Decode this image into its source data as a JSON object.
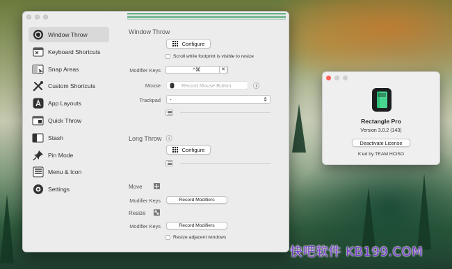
{
  "sidebar": {
    "items": [
      {
        "label": "Window Throw",
        "icon": "target-icon"
      },
      {
        "label": "Keyboard Shortcuts",
        "icon": "keyboard-window-icon"
      },
      {
        "label": "Snap Areas",
        "icon": "snap-areas-icon"
      },
      {
        "label": "Custom Shortcuts",
        "icon": "tools-icon"
      },
      {
        "label": "App Layouts",
        "icon": "app-store-icon"
      },
      {
        "label": "Quick Throw",
        "icon": "quick-throw-icon"
      },
      {
        "label": "Stash",
        "icon": "stash-icon"
      },
      {
        "label": "Pin Mode",
        "icon": "pin-icon"
      },
      {
        "label": "Menu & Icon",
        "icon": "menu-icon"
      },
      {
        "label": "Settings",
        "icon": "settings-icon"
      }
    ],
    "selected_index": 0
  },
  "window_throw": {
    "title": "Window Throw",
    "configure_label": "Configure",
    "scroll_checkbox_label": "Scroll while footprint is visible to resize",
    "modifier_keys_label": "Modifier Keys",
    "modifier_keys_value": "^⌘",
    "clear_symbol": "✕",
    "mouse_label": "Mouse",
    "mouse_placeholder": "Record Mouse Button",
    "info_symbol": "ⓘ",
    "trackpad_label": "Trackpad",
    "trackpad_value": "-",
    "select_arrows": "⇕"
  },
  "long_throw": {
    "title": "Long Throw",
    "info_symbol": "ⓘ",
    "configure_label": "Configure"
  },
  "move_resize": {
    "move_label": "Move",
    "resize_label": "Resize",
    "modifier_keys_label": "Modifier Keys",
    "record_modifiers_label": "Record Modifiers",
    "resize_adjacent_label": "Resize adjacent windows"
  },
  "license_window": {
    "app_name": "Rectangle Pro",
    "version": "Version 3.0.2 (143)",
    "deactivate_label": "Deactivate License",
    "credit": "K'ed by TEAM HCiSO",
    "close_color": "#ff5f57",
    "minimize_color": "#d0d0d0",
    "zoom_color": "#d0d0d0"
  },
  "watermark": "快吧软件 KB199.COM",
  "colors": {
    "accent_green": "#2fbf7a",
    "window_bg": "#ececec"
  }
}
